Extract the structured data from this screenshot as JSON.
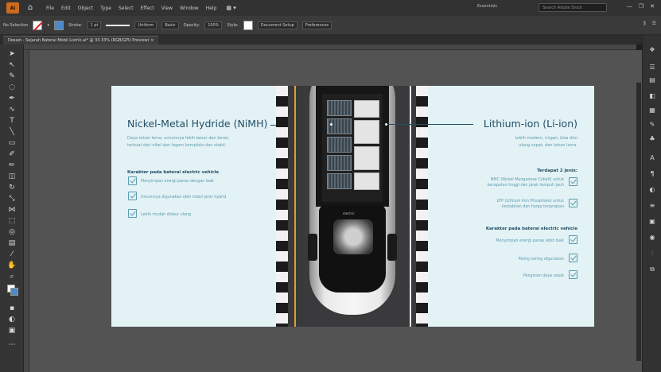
{
  "app": {
    "logo_text": "Ai",
    "menu": [
      "File",
      "Edit",
      "Object",
      "Type",
      "Select",
      "Effect",
      "View",
      "Window",
      "Help"
    ],
    "workspace": "Essentials",
    "search_placeholder": "Search Adobe Stock"
  },
  "control_bar": {
    "selection_label": "No Selection",
    "stroke_label": "Stroke:",
    "stroke_weight": "1 pt",
    "brush_uniform": "Uniform",
    "brush_basic": "Basic",
    "opacity_label": "Opacity:",
    "opacity_value": "100%",
    "style_label": "Style:",
    "document_setup": "Document Setup",
    "preferences": "Preferences"
  },
  "tab": {
    "title": "Desain - Sejarah Baterai Mobil Listrik.ai* @ 33.33% (RGB/GPU Preview)",
    "close": "×"
  },
  "artboard": {
    "left": {
      "title": "Nickel-Metal Hydride (NiMH)",
      "subtitle_lines": [
        "Daya tahan lama, umumnya lebih besar dan berat,",
        "terbuat dari nikel dan logam kompleks dan stabil."
      ],
      "heading": "Karakter pada baterai electric vehicle",
      "items": [
        "Menyimpan energi panas dengan baik",
        "Umumnya digunakan oleh mobil jenis hybrid",
        "Lebih mudah didaur ulang"
      ]
    },
    "right": {
      "title": "Lithium-ion (Li-ion)",
      "subtitle_lines": [
        "Lebih modern, ringan, bisa diisi",
        "ulang cepat, dan tahan lama."
      ],
      "types_heading": "Terdapat 2 jenis:",
      "types": [
        [
          "NMC (Nickel Manganese Cobalt) untuk",
          "kecepatan tinggi dan jarak tempuh jauh"
        ],
        [
          "LFP (Lithium Iron Phosphate) untuk",
          "kestabilan dan harga terjangkau"
        ]
      ],
      "heading": "Karakter pada baterai electric vehicle",
      "items": [
        "Menyimpan energi panas lebih baik",
        "Paling sering digunakan",
        "Pengisian daya cepat"
      ]
    },
    "car_label": "electric"
  },
  "colors": {
    "artboard_bg": "#e2f2f5",
    "title": "#234e66",
    "accent": "#5f9bb0",
    "road_line": "#d9a327"
  }
}
